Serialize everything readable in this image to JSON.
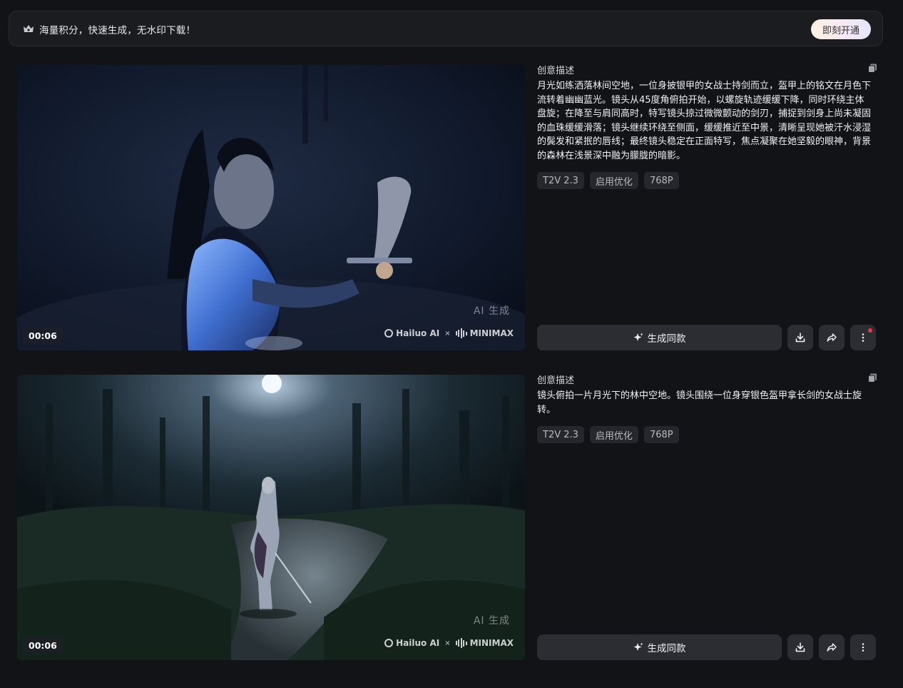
{
  "banner": {
    "icon": "crown-icon",
    "text": "海量积分，快速生成，无水印下载！",
    "button_label": "即刻开通"
  },
  "cards": [
    {
      "duration": "00:06",
      "watermark_ai": "AI 生成",
      "watermark_brand_1": "Hailuo AI",
      "watermark_sep": "×",
      "watermark_brand_2": "MINIMAX",
      "info_title": "创意描述",
      "description": "月光如练洒落林间空地，一位身披银甲的女战士持剑而立，盔甲上的铭文在月色下流转着幽幽蓝光。镜头从45度角俯拍开始，以螺旋轨迹缓缓下降，同时环绕主体盘旋；在降至与肩同高时，特写镜头掠过微微颤动的剑刃，捕捉到剑身上尚未凝固的血珠缓缓滑落；镜头继续环绕至侧面，缓缓推近至中景，清晰呈现她被汗水浸湿的鬓发和紧抿的唇线；最终镜头稳定在正面特写，焦点凝聚在她坚毅的眼神，背景的森林在浅景深中融为朦胧的暗影。",
      "tags": [
        "T2V 2.3",
        "启用优化",
        "768P"
      ],
      "generate_label": "生成同款",
      "has_notification_dot": true
    },
    {
      "duration": "00:06",
      "watermark_ai": "AI 生成",
      "watermark_brand_1": "Hailuo AI",
      "watermark_sep": "×",
      "watermark_brand_2": "MINIMAX",
      "info_title": "创意描述",
      "description": "镜头俯拍一片月光下的林中空地。镜头围绕一位身穿银色盔甲拿长剑的女战士旋转。",
      "tags": [
        "T2V 2.3",
        "启用优化",
        "768P"
      ],
      "generate_label": "生成同款",
      "has_notification_dot": false
    }
  ]
}
